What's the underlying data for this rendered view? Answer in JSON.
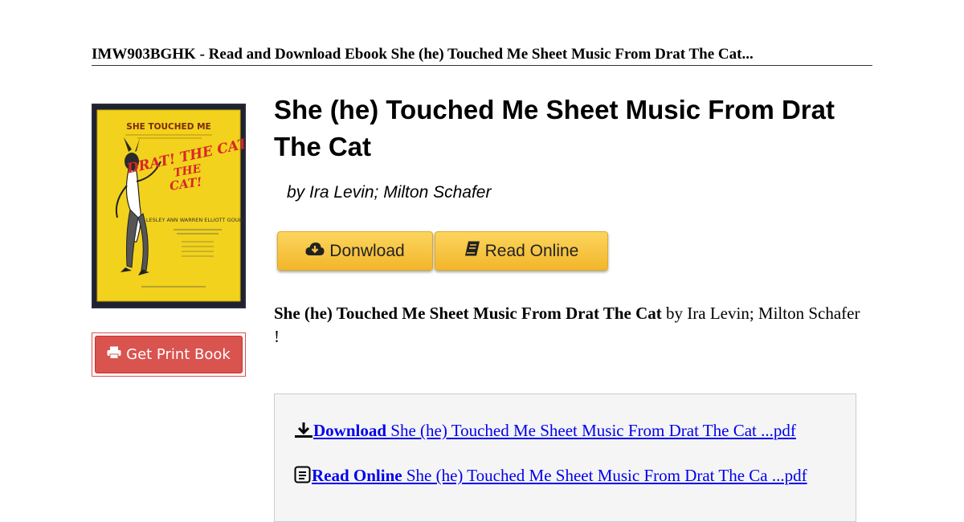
{
  "header": {
    "title": "IMW903BGHK - Read and Download Ebook She (he) Touched Me Sheet Music From Drat The Cat..."
  },
  "cover": {
    "top_text": "SHE TOUCHED ME",
    "show_title": "DRAT! THE CAT!",
    "cast": "LESLEY ANN WARREN  ELLIOTT GOULD",
    "accent_color": "#f7d400"
  },
  "sidebar": {
    "print_button_label": "Get Print Book",
    "print_button_color": "#d9534f"
  },
  "book": {
    "title": "She (he) Touched Me Sheet Music From Drat The Cat",
    "authors": "by Ira Levin; Milton Schafer"
  },
  "actions": {
    "download_label": "Donwload",
    "read_online_label": "Read Online",
    "button_color": "#f6c342"
  },
  "description": {
    "title_bold": "She (he) Touched Me Sheet Music From Drat The Cat",
    "by_text": " by Ira Levin; Milton Schafer",
    "exclaim": "!"
  },
  "links": {
    "download_bold": "Download",
    "download_text": " She (he) Touched Me Sheet Music From Drat The Cat ...pdf",
    "read_bold": "Read Online",
    "read_text": " She (he) Touched Me Sheet Music From Drat The Ca ...pdf"
  }
}
